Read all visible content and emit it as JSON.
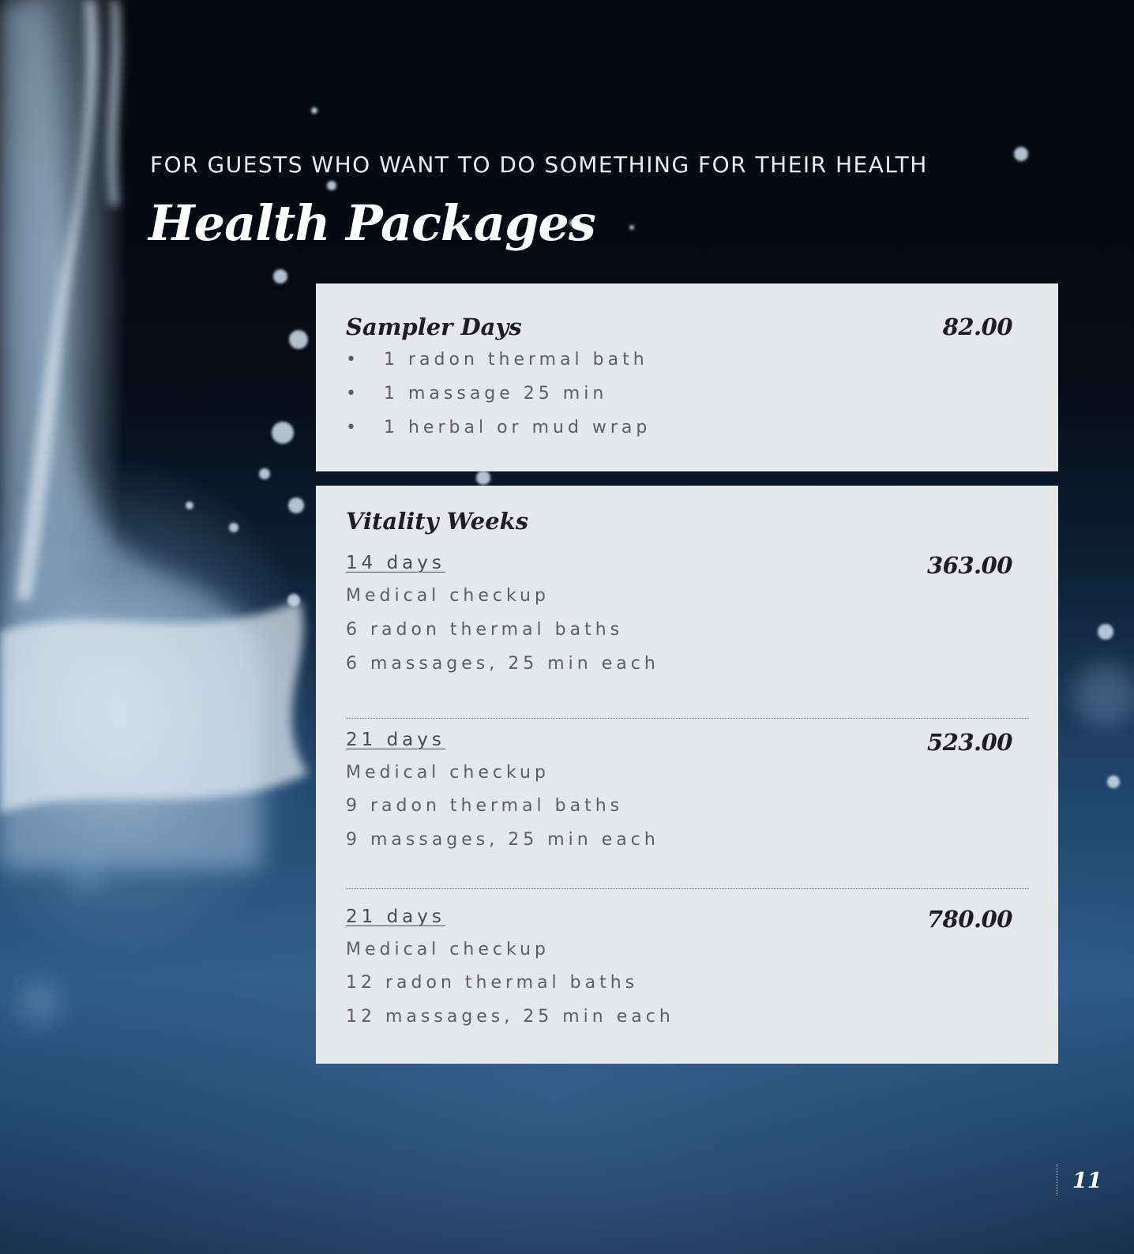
{
  "header": {
    "eyebrow": "FOR GUESTS WHO WANT TO DO SOMETHING FOR THEIR HEALTH",
    "title": "Health Packages"
  },
  "sampler": {
    "title": "Sampler Days",
    "price": "82.00",
    "items": [
      "1 radon thermal bath",
      "1 massage 25 min",
      "1 herbal or mud wrap"
    ]
  },
  "vitality": {
    "title": "Vitality Weeks",
    "options": [
      {
        "duration": "14 days",
        "price": "363.00",
        "items": [
          "Medical checkup",
          "6 radon thermal baths",
          "6 massages, 25 min each"
        ]
      },
      {
        "duration": "21 days",
        "price": "523.00",
        "items": [
          "Medical checkup",
          "9 radon thermal baths",
          "9 massages, 25 min each"
        ]
      },
      {
        "duration": "21 days",
        "price": "780.00",
        "items": [
          "Medical checkup",
          "12 radon thermal baths",
          "12 massages, 25 min each"
        ]
      }
    ]
  },
  "footer": {
    "page_number": "11"
  }
}
